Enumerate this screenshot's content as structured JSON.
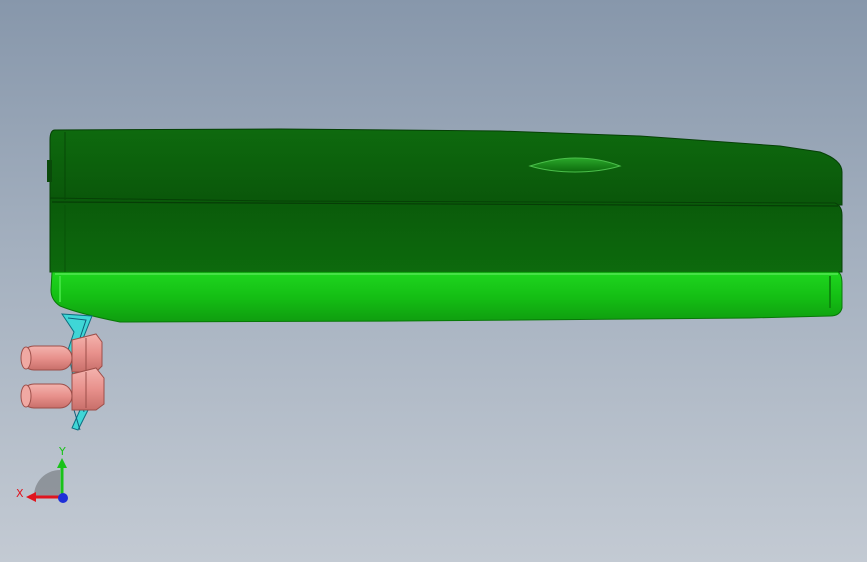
{
  "viewport": {
    "background_top": "#8797ab",
    "background_bottom": "#c3cad3"
  },
  "model": {
    "body_color_dark": "#0b5a0b",
    "body_color_light": "#12c012",
    "bracket_color": "#3fd6d6",
    "bolt_color": "#e8918c"
  },
  "triad": {
    "x_label": "X",
    "y_label": "Y",
    "x_color": "#e0141e",
    "y_color": "#19c219",
    "z_color": "#1e2fd8"
  }
}
